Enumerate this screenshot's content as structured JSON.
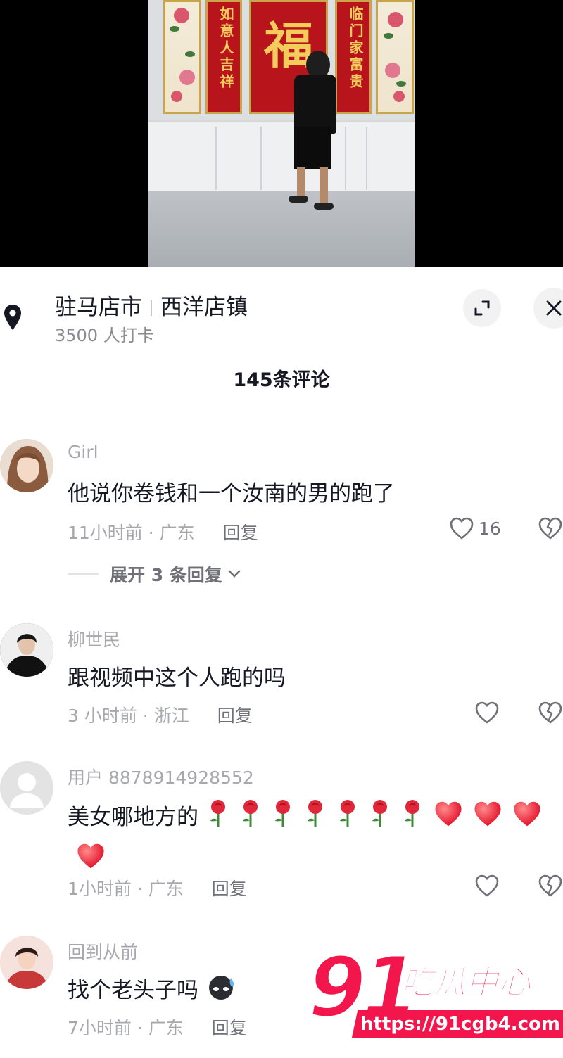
{
  "location": {
    "city": "驻马店市",
    "town": "西洋店镇",
    "checkins": "3500 人打卡"
  },
  "comments_header": {
    "count_label": "145条评论"
  },
  "comments": [
    {
      "user": "Girl",
      "text": "他说你卷钱和一个汝南的男的跑了",
      "meta": "11小时前 · 广东",
      "reply_label": "回复",
      "likes": "16",
      "expand_label": "展开 3 条回复"
    },
    {
      "user": "柳世民",
      "text": "跟视频中这个人跑的吗",
      "meta": "3 小时前 · 浙江",
      "reply_label": "回复"
    },
    {
      "user": "用户 8878914928552",
      "text": "美女哪地方的",
      "meta": "1小时前 · 广东",
      "reply_label": "回复",
      "emojis": [
        "rose-icon",
        "rose-icon",
        "rose-icon",
        "rose-icon",
        "rose-icon",
        "rose-icon",
        "rose-icon",
        "heart-emoji",
        "heart-emoji",
        "heart-emoji",
        "heart-emoji"
      ]
    },
    {
      "user": "回到从前",
      "text": "找个老头子吗",
      "meta": "7小时前 · 广东",
      "reply_label": "回复",
      "emojis": [
        "sweat-emoji"
      ]
    }
  ],
  "video": {
    "couplet_left": "如意人吉祥",
    "couplet_right": "临门家富贵",
    "center_char": "福"
  },
  "watermark": {
    "number": "91",
    "name": "吃瓜中心",
    "url": "https://91cgb4.com"
  },
  "colors": {
    "accent": "#f2164d",
    "text": "#161823",
    "muted": "#a7a8ad"
  }
}
